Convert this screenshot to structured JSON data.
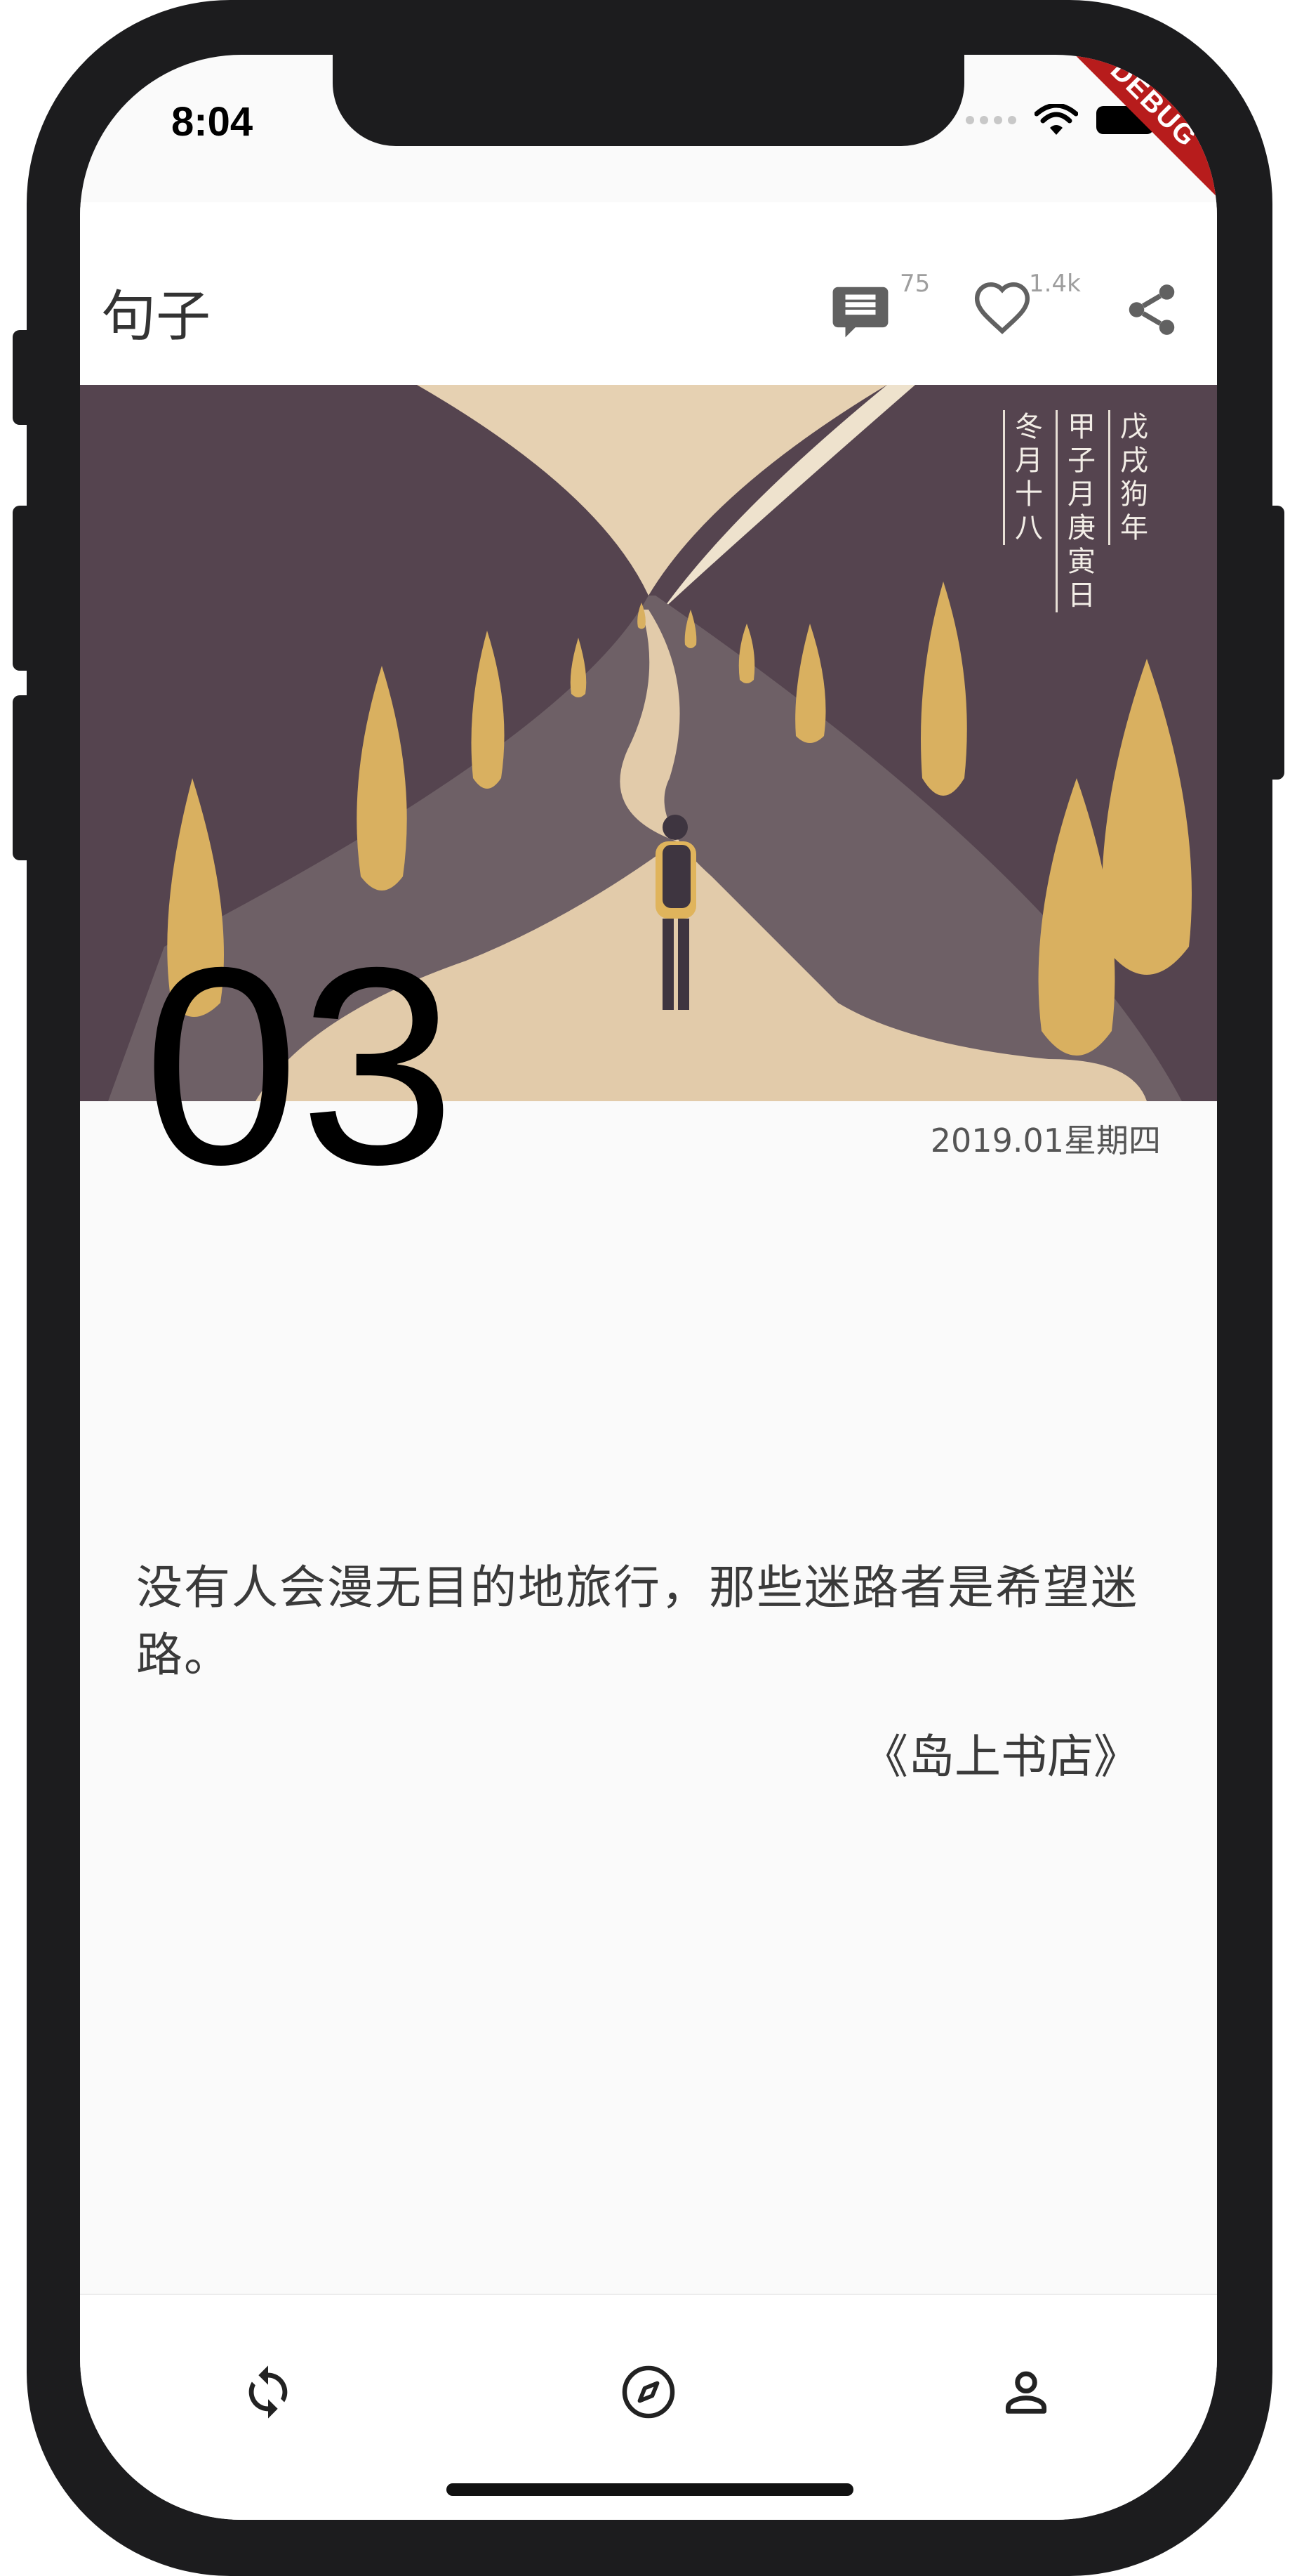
{
  "status_bar": {
    "time": "8:04",
    "debug_label": "DEBUG"
  },
  "app_bar": {
    "title": "句子",
    "comment_count": "75",
    "like_count": "1.4k"
  },
  "icons": {
    "comment": "comment-icon",
    "like": "heart-outline-icon",
    "share": "share-icon",
    "refresh": "refresh-icon",
    "discover": "compass-icon",
    "profile": "person-icon"
  },
  "hero": {
    "lunar_col1": [
      "戊",
      "戌",
      "狗",
      "年"
    ],
    "lunar_col2": [
      "甲",
      "子",
      "月",
      "庚",
      "寅",
      "日"
    ],
    "lunar_col3": [
      "冬",
      "月",
      "十",
      "八"
    ]
  },
  "card": {
    "day": "03",
    "date": "2019.01星期四",
    "quote": "没有人会漫无目的地旅行，那些迷路者是希望迷路。",
    "source": "《岛上书店》"
  },
  "colors": {
    "hill": "#55444f",
    "road": "#6e6066",
    "path": "#e2cbaa",
    "sky": "#e6d1b2",
    "tree": "#d9b060"
  }
}
